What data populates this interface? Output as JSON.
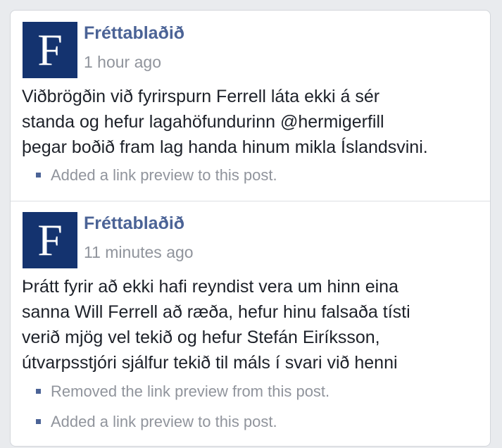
{
  "posts": [
    {
      "avatar_letter": "F",
      "author": "Fréttablaðið",
      "time": "1 hour ago",
      "body_lines": [
        "Viðbrögðin við fyrirspurn Ferrell láta ekki á sér",
        "standa og hefur lagahöfundurinn @hermigerfill",
        "þegar boðið fram lag handa hinum mikla Íslandsvini."
      ],
      "edits": [
        "Added a link preview to this post."
      ]
    },
    {
      "avatar_letter": "F",
      "author": "Fréttablaðið",
      "time": "11 minutes ago",
      "body_lines": [
        "Þrátt fyrir að ekki hafi reyndist vera um hinn eina",
        "sanna Will Ferrell að ræða, hefur hinu falsaða tísti",
        "verið mjög vel tekið og hefur Stefán Eiríksson,",
        "útvarpsstjóri sjálfur tekið til máls í svari við henni"
      ],
      "edits": [
        "Removed the link preview from this post.",
        "Added a link preview to this post."
      ]
    }
  ],
  "colors": {
    "avatar_bg": "#14336f",
    "author_name": "#4b6396",
    "muted_text": "#90949c",
    "body_text": "#1d2129",
    "page_bg": "#e9ebee"
  }
}
